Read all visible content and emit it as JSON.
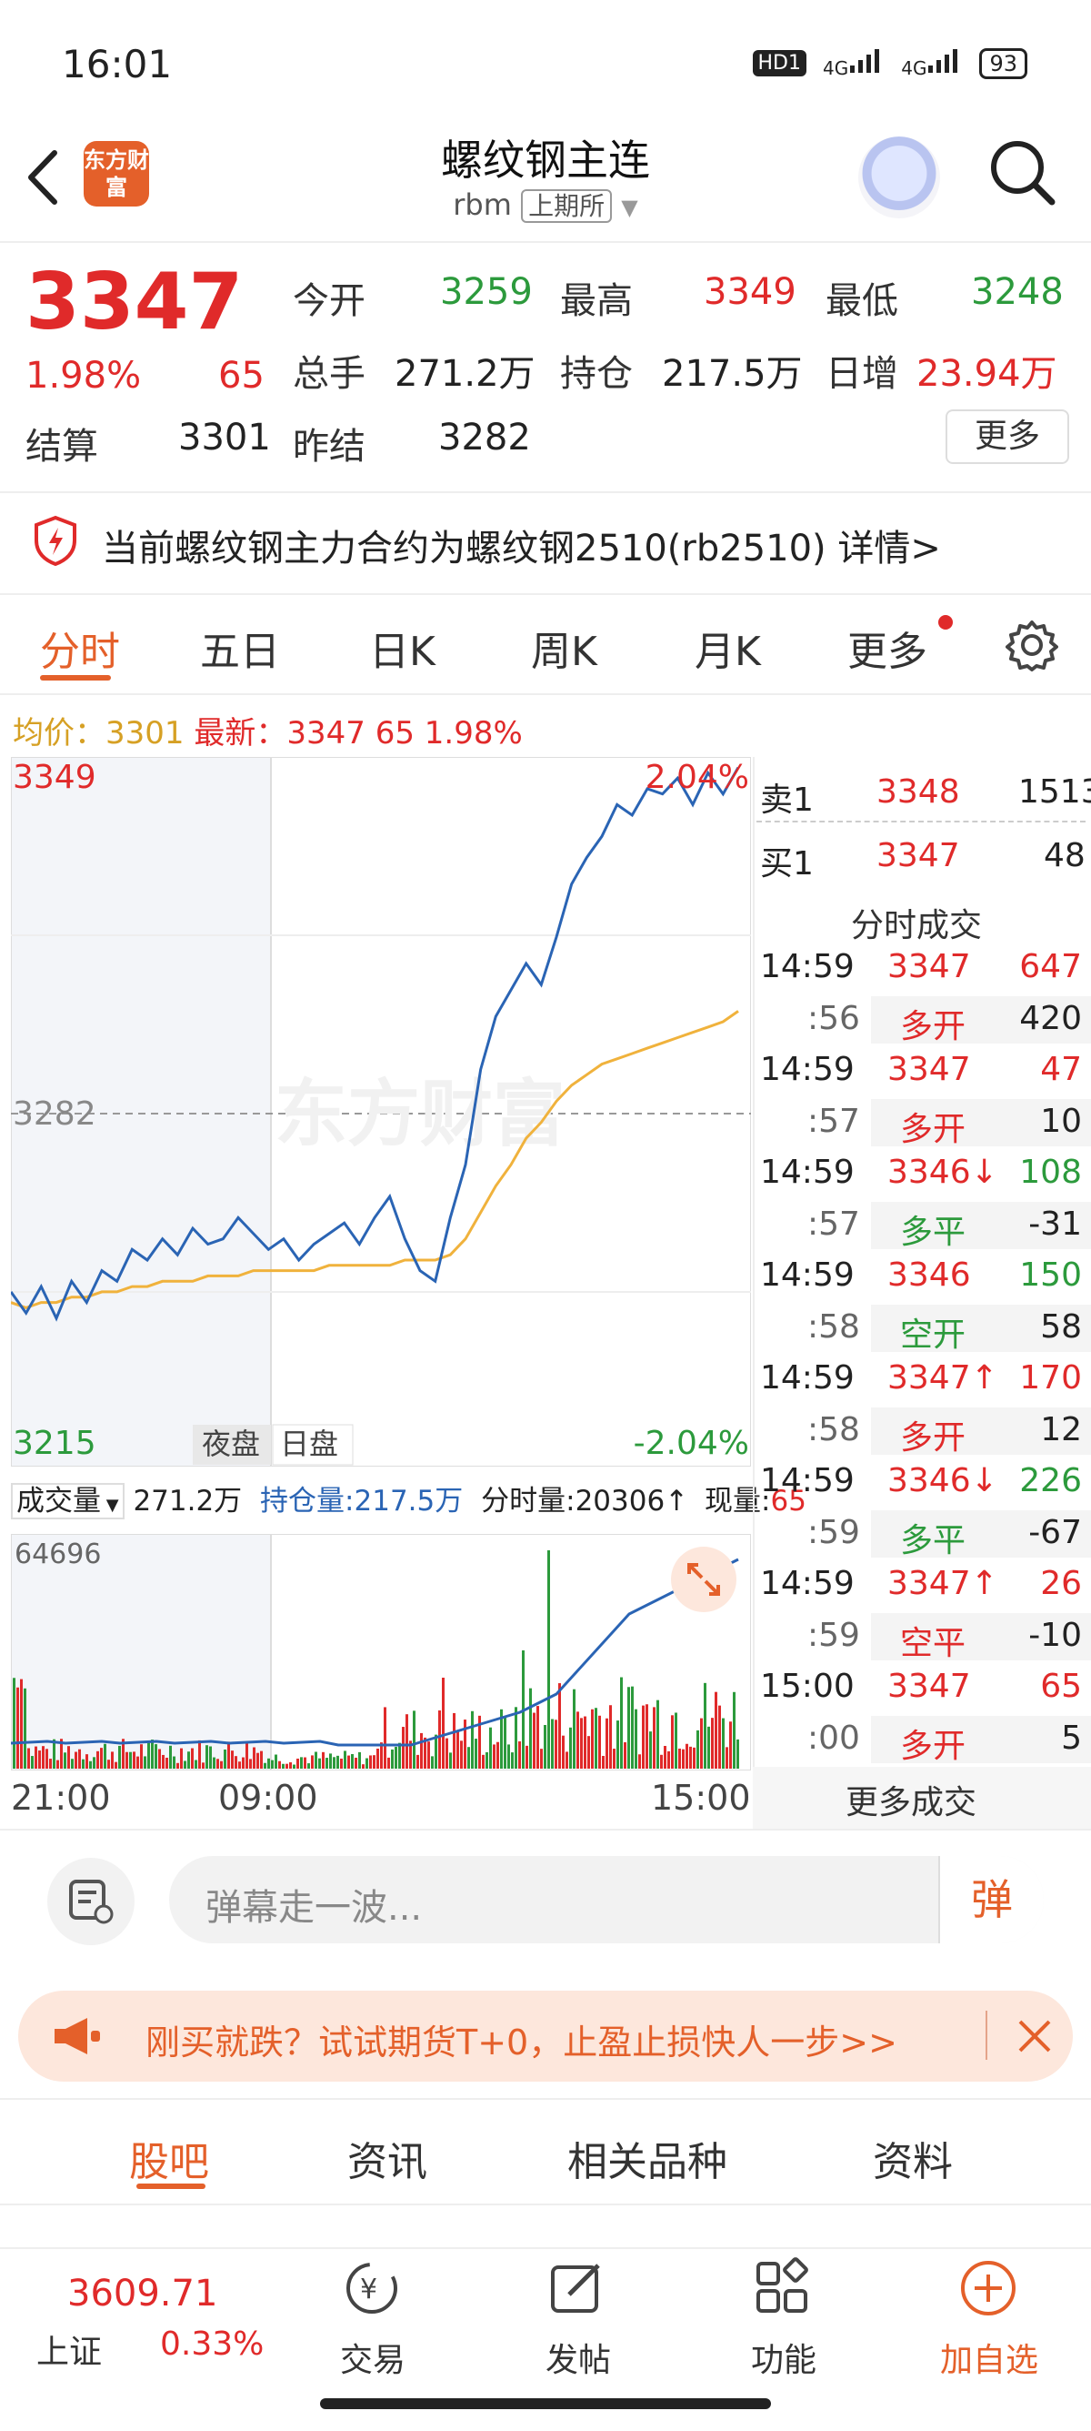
{
  "status": {
    "time": "16:01",
    "hd": "HD1",
    "net1": "4G",
    "net2": "4G",
    "battery": "93"
  },
  "header": {
    "logo": "东方财富",
    "title": "螺纹钢主连",
    "code": "rbm",
    "exchange": "上期所"
  },
  "quote": {
    "price": "3347",
    "change_pct": "1.98%",
    "change": "65",
    "open_label": "今开",
    "open": "3259",
    "high_label": "最高",
    "high": "3349",
    "low_label": "最低",
    "low": "3248",
    "volume_label": "总手",
    "volume": "271.2万",
    "oi_label": "持仓",
    "oi": "217.5万",
    "daily_inc_label": "日增",
    "daily_inc": "23.94万",
    "settle_label": "结算",
    "settle": "3301",
    "prev_settle_label": "昨结",
    "prev_settle": "3282",
    "more_label": "更多"
  },
  "notice": {
    "text": "当前螺纹钢主力合约为螺纹钢2510(rb2510)",
    "link": "详情>"
  },
  "chart_tabs": [
    "分时",
    "五日",
    "日K",
    "周K",
    "月K",
    "更多"
  ],
  "avg_line": {
    "avg_label": "均价：",
    "avg": "3301",
    "latest_label": "最新：",
    "latest": "3347",
    "chg": "65",
    "pct": "1.98%"
  },
  "chart_data": {
    "type": "line",
    "title": "",
    "y_top": "3349",
    "y_mid": "3282",
    "y_bottom": "3215",
    "pct_top": "2.04%",
    "pct_bottom": "-2.04%",
    "ylim": [
      3215,
      3349
    ],
    "session_labels": [
      "夜盘",
      "日盘"
    ],
    "x_ticks": [
      "21:00",
      "09:00",
      "15:00"
    ],
    "series": [
      {
        "color": "#2a64b4",
        "values": [
          3248,
          3244,
          3249,
          3243,
          3250,
          3246,
          3252,
          3250,
          3256,
          3254,
          3258,
          3255,
          3260,
          3257,
          3258,
          3262,
          3259,
          3256,
          3258,
          3254,
          3257,
          3259,
          3261,
          3257,
          3262,
          3266,
          3258,
          3252,
          3250,
          3262,
          3272,
          3290,
          3300,
          3305,
          3310,
          3306,
          3315,
          3325,
          3330,
          3334,
          3340,
          3338,
          3343,
          3342,
          3345,
          3340,
          3346,
          3342,
          3347
        ]
      },
      {
        "color": "#f0b23c",
        "values": [
          3246,
          3245,
          3246,
          3246,
          3247,
          3247,
          3248,
          3248,
          3249,
          3249,
          3250,
          3250,
          3250,
          3251,
          3251,
          3251,
          3252,
          3252,
          3252,
          3252,
          3252,
          3253,
          3253,
          3253,
          3253,
          3253,
          3254,
          3254,
          3254,
          3255,
          3258,
          3263,
          3268,
          3272,
          3277,
          3280,
          3284,
          3287,
          3289,
          3291,
          3292,
          3293,
          3294,
          3295,
          3296,
          3297,
          3298,
          3299,
          3301
        ]
      }
    ]
  },
  "volume_panel": {
    "label": "成交量",
    "vol": "271.2万",
    "oi_label": "持仓量:",
    "oi": "217.5万",
    "tick_label": "分时量:",
    "tick": "20306",
    "now_label": "现量:",
    "now": "65",
    "max": "64696"
  },
  "orderbook": {
    "sell_label": "卖1",
    "sell_price": "3348",
    "sell_vol": "1513",
    "buy_label": "买1",
    "buy_price": "3347",
    "buy_vol": "48",
    "ticks_title": "分时成交",
    "ticks": [
      {
        "t": "14:59",
        "p": "3347",
        "arrow": "",
        "v": "647",
        "s": ":56",
        "k": "多开",
        "kc": "red",
        "n": "420"
      },
      {
        "t": "14:59",
        "p": "3347",
        "arrow": "",
        "v": "47",
        "s": ":57",
        "k": "多开",
        "kc": "red",
        "n": "10"
      },
      {
        "t": "14:59",
        "p": "3346",
        "arrow": "↓",
        "v": "108",
        "s": ":57",
        "k": "多平",
        "kc": "green",
        "n": "-31"
      },
      {
        "t": "14:59",
        "p": "3346",
        "arrow": "",
        "v": "150",
        "s": ":58",
        "k": "空开",
        "kc": "green",
        "n": "58"
      },
      {
        "t": "14:59",
        "p": "3347",
        "arrow": "↑",
        "v": "170",
        "s": ":58",
        "k": "多开",
        "kc": "red",
        "n": "12"
      },
      {
        "t": "14:59",
        "p": "3346",
        "arrow": "↓",
        "v": "226",
        "s": ":59",
        "k": "多平",
        "kc": "green",
        "n": "-67"
      },
      {
        "t": "14:59",
        "p": "3347",
        "arrow": "↑",
        "v": "26",
        "s": ":59",
        "k": "空平",
        "kc": "red",
        "n": "-10"
      },
      {
        "t": "15:00",
        "p": "3347",
        "arrow": "",
        "v": "65",
        "s": ":00",
        "k": "多开",
        "kc": "red",
        "n": "5"
      }
    ],
    "more": "更多成交"
  },
  "danmu": {
    "placeholder": "弹幕走一波...",
    "btn": "弹"
  },
  "promo": {
    "text": "刚买就跌？试试期货T+0，止盈止损快人一步>>"
  },
  "bottom_tabs": [
    "股吧",
    "资讯",
    "相关品种",
    "资料"
  ],
  "tabbar": {
    "index_value": "3609.71",
    "index_name": "上证",
    "index_pct": "0.33%",
    "items": [
      "交易",
      "发帖",
      "功能",
      "加自选"
    ]
  }
}
